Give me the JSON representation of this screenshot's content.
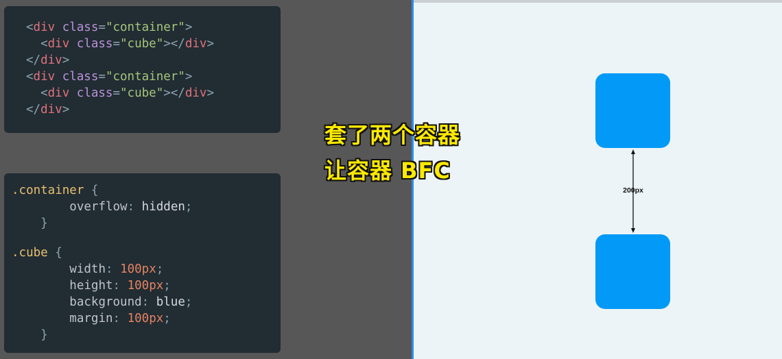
{
  "html_code": {
    "lines": [
      [
        "<",
        "div",
        "class",
        "=",
        "\"container\"",
        ">"
      ],
      [
        "<",
        "div",
        "class",
        "=",
        "\"cube\"",
        "></",
        "div",
        ">"
      ],
      [
        "</",
        "div",
        ">"
      ],
      [
        "<",
        "div",
        "class",
        "=",
        "\"container\"",
        ">"
      ],
      [
        "<",
        "div",
        "class",
        "=",
        "\"cube\"",
        "></",
        "div",
        ">"
      ],
      [
        "</",
        "div",
        ">"
      ]
    ]
  },
  "css_code": {
    "container_selector": ".container",
    "container_prop": "overflow",
    "container_value": "hidden",
    "cube_selector": ".cube",
    "cube_props": [
      {
        "prop": "width",
        "value": "100px"
      },
      {
        "prop": "height",
        "value": "100px"
      },
      {
        "prop": "background",
        "value": "blue"
      },
      {
        "prop": "margin",
        "value": "100px"
      }
    ]
  },
  "caption": {
    "line1": "套了两个容器",
    "line2": "让容器 BFC"
  },
  "preview": {
    "gap_label": "200px",
    "cube_color": "#0399f7"
  }
}
